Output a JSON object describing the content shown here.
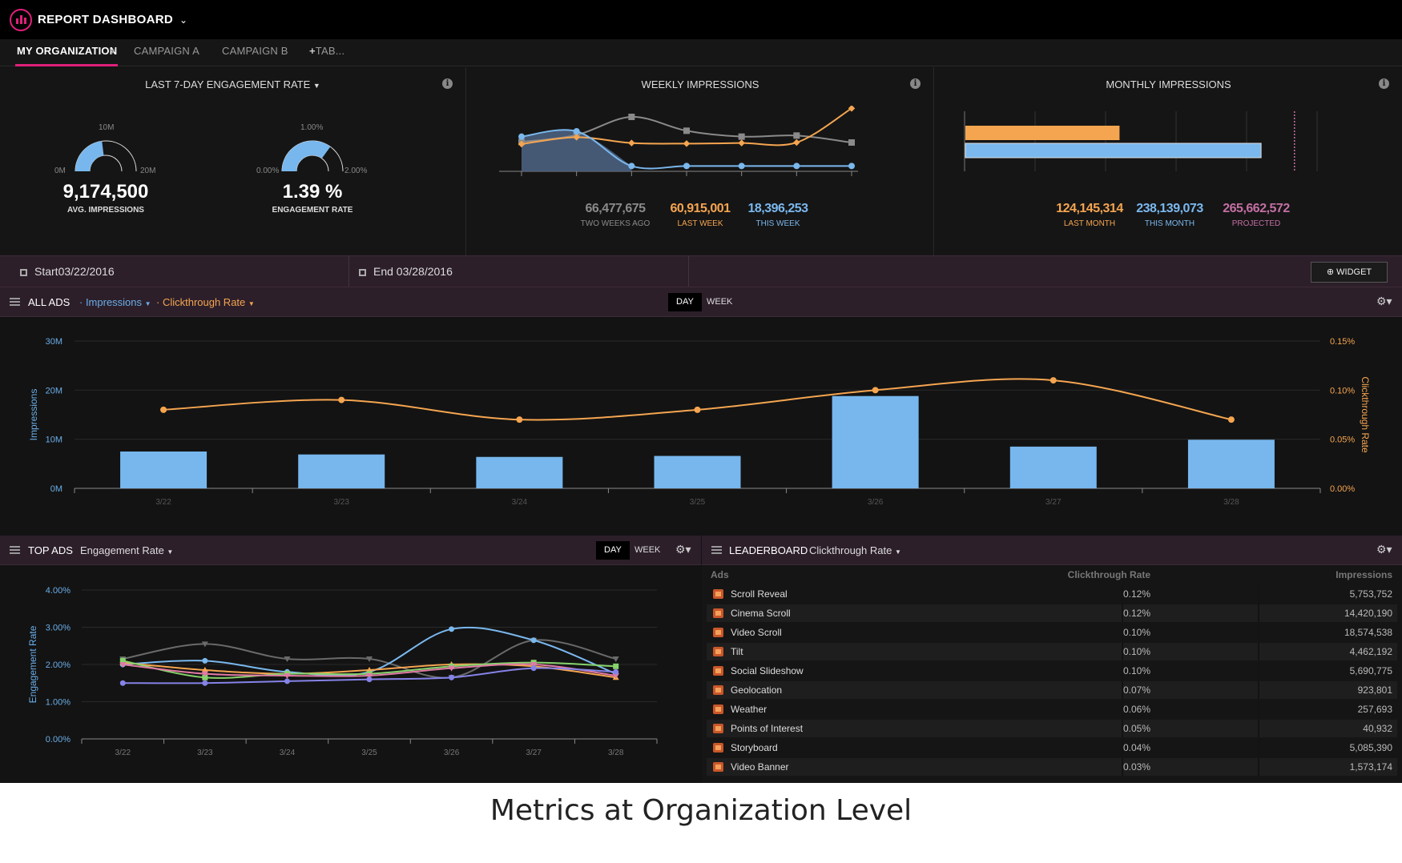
{
  "app": {
    "title": "REPORT DASHBOARD",
    "logo_icon": "bar-chart-icon"
  },
  "tabs": [
    {
      "label": "MY ORGANIZATION",
      "active": true
    },
    {
      "label": "CAMPAIGN A",
      "active": false
    },
    {
      "label": "CAMPAIGN B",
      "active": false
    },
    {
      "label": "TAB...",
      "active": false
    }
  ],
  "engagement_panel": {
    "title": "LAST 7-DAY ENGAGEMENT RATE",
    "gauges": [
      {
        "min": "0M",
        "max": "20M",
        "top": "10M",
        "value": "9,174,500",
        "caption": "AVG. IMPRESSIONS",
        "fill": 0.46
      },
      {
        "min": "0.00%",
        "max": "2.00%",
        "top": "1.00%",
        "value": "1.39 %",
        "caption": "ENGAGEMENT RATE",
        "fill": 0.7
      }
    ]
  },
  "weekly_panel": {
    "title": "WEEKLY IMPRESSIONS",
    "stats": [
      {
        "value": "66,477,675",
        "label": "TWO WEEKS AGO",
        "color": "#8a8a8a"
      },
      {
        "value": "60,915,001",
        "label": "LAST WEEK",
        "color": "#f5a550"
      },
      {
        "value": "18,396,253",
        "label": "THIS WEEK",
        "color": "#7ab8ee"
      }
    ]
  },
  "monthly_panel": {
    "title": "MONTHLY IMPRESSIONS",
    "stats": [
      {
        "value": "124,145,314",
        "label": "LAST MONTH",
        "color": "#f5a550"
      },
      {
        "value": "238,139,073",
        "label": "THIS MONTH",
        "color": "#7ab8ee"
      },
      {
        "value": "265,662,572",
        "label": "PROJECTED",
        "color": "#c46fa3"
      }
    ],
    "bars": {
      "last_month": 124145314,
      "this_month": 238139073,
      "projected": 265662572
    }
  },
  "datebar": {
    "start": "Start03/22/2016",
    "end": "End 03/28/2016",
    "widget_label": "WIDGET"
  },
  "all_ads": {
    "title": "ALL ADS",
    "metric1": "· Impressions",
    "metric2": "· Clickthrough Rate",
    "day": "DAY",
    "week": "WEEK"
  },
  "top_ads": {
    "title": "TOP ADS",
    "metric": "Engagement Rate",
    "day": "DAY",
    "week": "WEEK"
  },
  "leaderboard": {
    "title": "LEADERBOARD",
    "metric": "Clickthrough Rate",
    "columns": [
      "Ads",
      "Clickthrough Rate",
      "Impressions"
    ],
    "rows": [
      {
        "name": "Scroll Reveal",
        "ctr": "0.12%",
        "imp": "5,753,752"
      },
      {
        "name": "Cinema Scroll",
        "ctr": "0.12%",
        "imp": "14,420,190"
      },
      {
        "name": "Video Scroll",
        "ctr": "0.10%",
        "imp": "18,574,538"
      },
      {
        "name": "Tilt",
        "ctr": "0.10%",
        "imp": "4,462,192"
      },
      {
        "name": "Social Slideshow",
        "ctr": "0.10%",
        "imp": "5,690,775"
      },
      {
        "name": "Geolocation",
        "ctr": "0.07%",
        "imp": "923,801"
      },
      {
        "name": "Weather",
        "ctr": "0.06%",
        "imp": "257,693"
      },
      {
        "name": "Points of Interest",
        "ctr": "0.05%",
        "imp": "40,932"
      },
      {
        "name": "Storyboard",
        "ctr": "0.04%",
        "imp": "5,085,390"
      },
      {
        "name": "Video Banner",
        "ctr": "0.03%",
        "imp": "1,573,174"
      }
    ]
  },
  "caption": "Metrics at Organization Level",
  "chart_data": [
    {
      "id": "weekly",
      "type": "line",
      "series": [
        {
          "name": "TWO WEEKS AGO",
          "color": "#8a8a8a",
          "values": [
            5.5,
            6.8,
            10.2,
            7.6,
            6.5,
            6.7,
            5.4
          ]
        },
        {
          "name": "LAST WEEK",
          "color": "#f5a550",
          "values": [
            5.1,
            6.4,
            5.3,
            5.2,
            5.3,
            5.4,
            11.8
          ]
        },
        {
          "name": "THIS WEEK",
          "color": "#7ab8ee",
          "values": [
            6.5,
            7.5,
            1.0,
            1.0,
            1.0,
            1.0,
            1.0
          ]
        }
      ],
      "ylim": [
        0,
        12
      ]
    },
    {
      "id": "all_ads",
      "type": "bar",
      "categories": [
        "3/22",
        "3/23",
        "3/24",
        "3/25",
        "3/26",
        "3/27",
        "3/28"
      ],
      "series": [
        {
          "name": "Impressions",
          "type": "bar",
          "axis": "left",
          "color": "#77b7ee",
          "values": [
            7.5,
            6.9,
            6.4,
            6.6,
            18.8,
            8.5,
            9.9
          ]
        },
        {
          "name": "Clickthrough Rate",
          "type": "line",
          "axis": "right",
          "color": "#f5a550",
          "values": [
            0.08,
            0.09,
            0.07,
            0.08,
            0.1,
            0.11,
            0.07
          ]
        }
      ],
      "ylabel": "Impressions",
      "y2label": "Clickthrough Rate",
      "yticks": [
        "0M",
        "10M",
        "20M",
        "30M"
      ],
      "y2ticks": [
        "0.00%",
        "0.05%",
        "0.10%",
        "0.15%"
      ],
      "ylim": [
        0,
        30
      ],
      "y2lim": [
        0,
        0.15
      ]
    },
    {
      "id": "top_ads",
      "type": "line",
      "categories": [
        "3/22",
        "3/23",
        "3/24",
        "3/25",
        "3/26",
        "3/27",
        "3/28"
      ],
      "series": [
        {
          "color": "#6a6a6a",
          "values": [
            2.15,
            2.55,
            2.15,
            2.15,
            1.65,
            2.65,
            2.15
          ]
        },
        {
          "color": "#7ab8ee",
          "values": [
            2.0,
            2.1,
            1.8,
            1.8,
            2.95,
            2.65,
            1.75
          ]
        },
        {
          "color": "#f5a550",
          "values": [
            2.05,
            1.85,
            1.75,
            1.85,
            2.0,
            1.95,
            1.65
          ]
        },
        {
          "color": "#86d36b",
          "values": [
            2.1,
            1.65,
            1.75,
            1.75,
            1.95,
            2.05,
            1.95
          ]
        },
        {
          "color": "#e07aa5",
          "values": [
            2.0,
            1.75,
            1.7,
            1.7,
            1.9,
            2.0,
            1.7
          ]
        },
        {
          "color": "#8583e8",
          "values": [
            1.5,
            1.5,
            1.55,
            1.6,
            1.65,
            1.9,
            1.8
          ]
        }
      ],
      "ylabel": "Engagement Rate",
      "yticks": [
        "0.00%",
        "1.00%",
        "2.00%",
        "3.00%",
        "4.00%"
      ],
      "ylim": [
        0,
        4
      ]
    }
  ]
}
